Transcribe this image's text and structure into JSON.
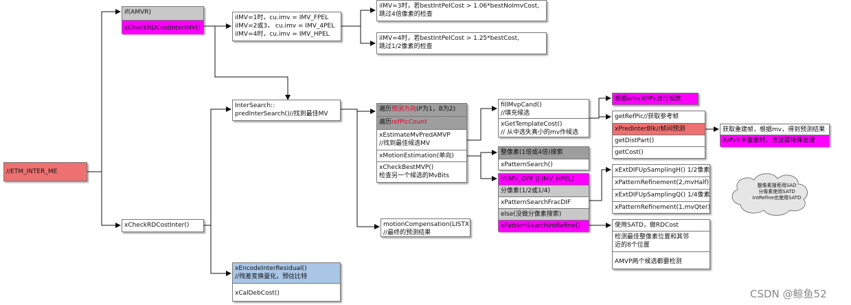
{
  "root": "//ETM_INTER_ME",
  "n_if_amvr": "if(AMVR)",
  "n_xcheck_rdcost_inter_imv": "xCheckRDCostInterIMV()",
  "n_imv_modes": "iIMV=1时，cu.imv = IMV_FPEL\niIMV=2或3， cu.imv = IMV_4PEL\niIMV=4时，cu.imv = IMV_HPEL",
  "n_imv3": "iIMV=3时，若bestIntPelCost > 1.06*bestNoImvCost,\n跳过4倍像素的检查",
  "n_imv4": "iIMV=4时，若bestIntPelCost > 1.25*bestCost,\n跳过1/2像素的检查",
  "n_intersearch": "InterSearch::\npredInterSearch()//找到最佳MV",
  "n_loop_dir_prefix": "遍历",
  "n_loop_dir_red": "预测方向",
  "n_loop_dir_suffix": "(P为1，B为2)",
  "n_loop_ref_prefix": "遍历",
  "n_loop_ref_red": "refPicCount",
  "n_xestimate": "xEstimateMvPredAMVP\n//找到最佳候选MV",
  "n_xmotion": "xMotionEstimation(单向)",
  "n_xcheckbest": "xCheckBestMVP()\n检查另一个候选的MvBits",
  "n_fillmvp": "fillMvpCand()\n//填充候选",
  "n_xgettemplate": "xGetTemplateCost()\n// 从中选失真小的mv作候选",
  "n_scale_mv": "根据amv对MV进行缩放",
  "n_getrefpic": "getRefPic//获取参考帧",
  "n_xpredinterblk": "xPredInterBlk//帧间预测",
  "n_getdistpart": "getDistPart()",
  "n_getcost": "getCost()",
  "n_rebuild": "获取重建帧，根据mv，得到预测结果",
  "n_amvr_half": "AMVR半像素时，滤波需特殊处理",
  "n_int_search": "整像素(1倍或4倍)搜索",
  "n_xpatternsearch": "xPatternSearch()",
  "n_if_imv_off": "if(IMV_OFF || IMV_HPEL)",
  "n_frac_pixel": "分像素(1/2或1/4)",
  "n_xpattern_frac": "xPatternSearchFracDIF",
  "n_else_frac": "else(没做分像素搜索)",
  "n_xpattern_refine": "xPatternSearchIntRefine()",
  "n_extdif_h": "xExtDIFUpSamplingH() 1/2像素",
  "n_refine_half": "xPatternRefinement(2,mvHalf)",
  "n_extdif_q": "xExtDIFUpSamplingQ() 1/4像素",
  "n_refine_qter": "xPatternRefinement(1,mvQter)",
  "n_satd_rd": "使用SATD，做RDCost",
  "n_detect_8": "检测最佳整像素位置和其邻\n近的8个位置",
  "n_amvp_both": "AMVP两个候选都要检测",
  "n_cloud": "整像素搜索用SAD\n分像素使用SATD\nIntRefine也使用SATD",
  "n_motion_comp": "motionCompensation(LISTX)\n//最终的预测结果",
  "n_xcheck_rdcost_inter": "xCheckRDCostInter()",
  "n_xencode_residual": "xEncodeInterResidual()\n//残差变换量化，预估比特",
  "n_xcaldebcost": "xCalDebCost()",
  "watermark": "CSDN @鲸鱼52",
  "colors": {
    "highlight_magenta": "#ff00ff",
    "highlight_red": "#ee7070",
    "header_gray": "#c8c8c8",
    "header_dark_gray": "#9e9e9e",
    "highlight_blue": "#a9c6e6",
    "red_text": "#e8002a"
  }
}
